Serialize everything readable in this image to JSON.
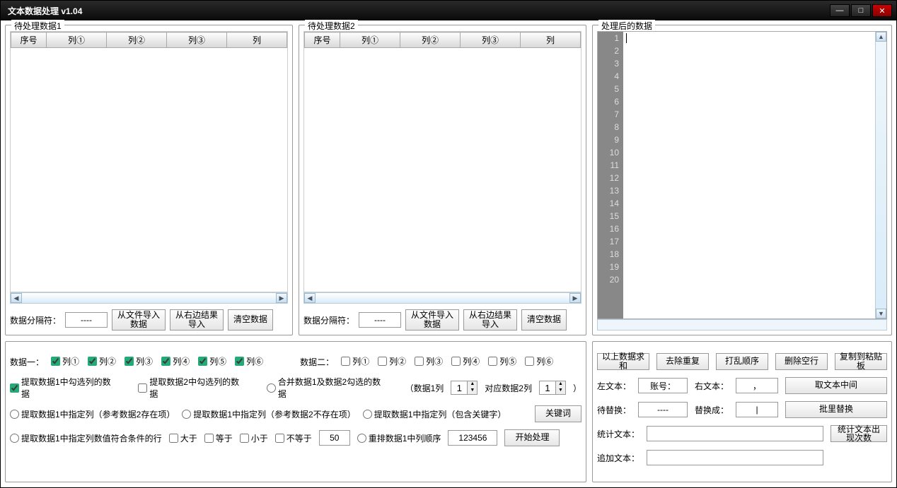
{
  "title": "文本数据处理  v1.04",
  "panel1": {
    "title": "待处理数据1",
    "cols": [
      "序号",
      "列①",
      "列②",
      "列③",
      "列"
    ],
    "sep_label": "数据分隔符：",
    "sep_value": "----",
    "btn_import": "从文件导入数据",
    "btn_fromright": "从右边结果导入",
    "btn_clear": "清空数据"
  },
  "panel2": {
    "title": "待处理数据2",
    "cols": [
      "序号",
      "列①",
      "列②",
      "列③",
      "列"
    ],
    "sep_label": "数据分隔符：",
    "sep_value": "----",
    "btn_import": "从文件导入数据",
    "btn_fromright": "从右边结果导入",
    "btn_clear": "清空数据"
  },
  "panel3": {
    "title": "处理后的数据",
    "lines": [
      "1",
      "2",
      "3",
      "4",
      "5",
      "6",
      "7",
      "8",
      "9",
      "10",
      "11",
      "12",
      "13",
      "14",
      "15",
      "16",
      "17",
      "18",
      "19",
      "20"
    ]
  },
  "ops": {
    "data1_label": "数据一：",
    "data1_cols": [
      "列①",
      "列②",
      "列③",
      "列④",
      "列⑤",
      "列⑥"
    ],
    "data1_checked": [
      true,
      true,
      true,
      true,
      true,
      true
    ],
    "data2_label": "数据二：",
    "data2_cols": [
      "列①",
      "列②",
      "列③",
      "列④",
      "列⑤",
      "列⑥"
    ],
    "data2_checked": [
      false,
      false,
      false,
      false,
      false,
      false
    ],
    "r1": "提取数据1中勾选列的数据",
    "r2": "提取数据2中勾选列的数据",
    "r3": "合并数据1及数据2勾选的数据",
    "paren_open": "（数据1列",
    "spin1": "1",
    "paren_mid": "对应数据2列",
    "spin2": "1",
    "paren_close": "）",
    "r4": "提取数据1中指定列（参考数据2存在项）",
    "r5": "提取数据1中指定列（参考数据2不存在项）",
    "r6": "提取数据1中指定列（包含关键字）",
    "btn_keyword": "关键词",
    "r7": "提取数据1中指定列数值符合条件的行",
    "c_gt": "大于",
    "c_eq": "等于",
    "c_lt": "小于",
    "c_ne": "不等于",
    "val_cond": "50",
    "r8": "重排数据1中列顺序",
    "val_reorder": "123456",
    "btn_start": "开始处理"
  },
  "right": {
    "btns": [
      "以上数据求和",
      "去除重复",
      "打乱顺序",
      "删除空行",
      "复制到粘贴板"
    ],
    "left_text": "左文本：",
    "left_val": "账号：",
    "right_text": "右文本：",
    "right_val": "，",
    "btn_mid": "取文本中间",
    "rep_from": "待替换：",
    "rep_from_val": "----",
    "rep_to": "替换成：",
    "rep_to_val": "|",
    "btn_rep": "批里替换",
    "stat_label": "统计文本：",
    "stat_val": "",
    "btn_stat": "统计文本出现次数",
    "append_label": "追加文本：",
    "append_val": ""
  }
}
